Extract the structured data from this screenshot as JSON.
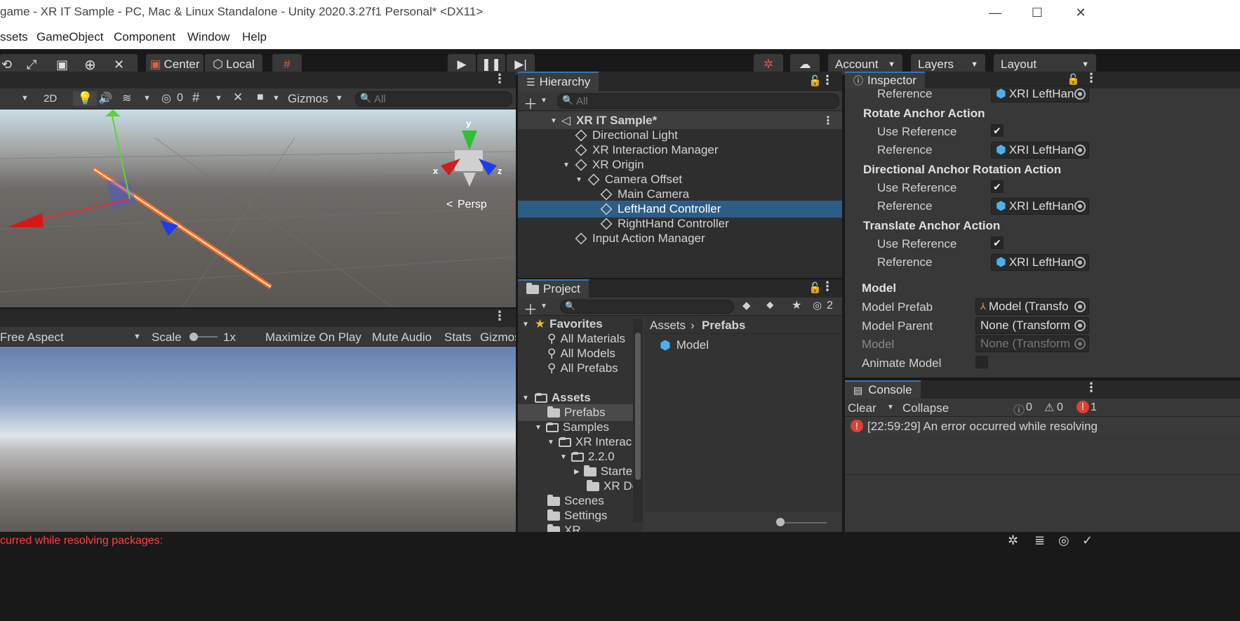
{
  "window": {
    "title": "game - XR IT Sample - PC, Mac & Linux Standalone - Unity 2020.3.27f1 Personal* <DX11>",
    "minimize": "—",
    "maximize": "☐",
    "close": "✕"
  },
  "menubar": [
    "ssets",
    "GameObject",
    "Component",
    "Window",
    "Help"
  ],
  "toolbar": {
    "center": "Center",
    "local": "Local",
    "account": "Account",
    "layers": "Layers",
    "layout": "Layout"
  },
  "scene": {
    "mode_2d": "2D",
    "hidden_count": "0",
    "gizmos": "Gizmos",
    "search_placeholder": "All",
    "persp": "Persp",
    "axis_x": "x",
    "axis_y": "y",
    "axis_z": "z"
  },
  "game": {
    "aspect": "Free Aspect",
    "scale_label": "Scale",
    "scale_value": "1x",
    "maximize": "Maximize On Play",
    "mute": "Mute Audio",
    "stats": "Stats",
    "gizmos": "Gizmos"
  },
  "hierarchy": {
    "title": "Hierarchy",
    "search_placeholder": "All",
    "scene": "XR IT Sample*",
    "items": [
      "Directional Light",
      "XR Interaction Manager",
      "XR Origin",
      "Camera Offset",
      "Main Camera",
      "LeftHand Controller",
      "RightHand Controller",
      "Input Action Manager"
    ]
  },
  "project": {
    "title": "Project",
    "hidden_count": "2",
    "breadcrumb_root": "Assets",
    "breadcrumb_leaf": "Prefabs",
    "favorites": "Favorites",
    "fav_items": [
      "All Materials",
      "All Models",
      "All Prefabs"
    ],
    "assets": "Assets",
    "folders": [
      "Prefabs",
      "Samples",
      "XR Interac",
      "2.2.0",
      "Starte",
      "XR De",
      "Scenes",
      "Settings",
      "XR"
    ],
    "content": [
      "Model"
    ]
  },
  "inspector": {
    "title": "Inspector",
    "top_ref_label": "Reference",
    "ref_value": "XRI LeftHan",
    "sections": [
      "Rotate Anchor Action",
      "Directional Anchor Rotation Action",
      "Translate Anchor Action"
    ],
    "use_ref": "Use Reference",
    "reference": "Reference",
    "model": "Model",
    "model_prefab": "Model Prefab",
    "model_prefab_value": "Model (Transfo",
    "model_parent": "Model Parent",
    "model_parent_value": "None (Transform",
    "model_field": "Model",
    "model_value": "None (Transform",
    "animate_model": "Animate Model"
  },
  "console": {
    "title": "Console",
    "clear": "Clear",
    "collapse": "Collapse",
    "info_count": "0",
    "warn_count": "0",
    "error_count": "1",
    "message": "[22:59:29] An error occurred while resolving"
  },
  "statusbar": {
    "message": "curred while resolving packages:"
  },
  "colors": {
    "accent": "#2c5d87",
    "error": "#ff4141",
    "dark_bg": "#191919",
    "panel": "#383838"
  }
}
